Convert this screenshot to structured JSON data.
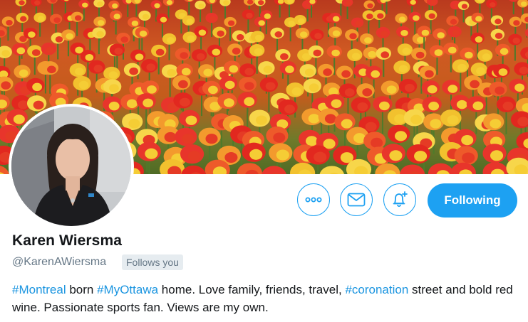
{
  "profile": {
    "name": "Karen Wiersma",
    "handle": "@KarenAWiersma",
    "follows_badge": "Follows you"
  },
  "bio": {
    "tag1": "#Montreal",
    "t1": " born ",
    "tag2": "#MyOttawa",
    "t2": " home. Love family, friends, travel, ",
    "tag3": "#coronation",
    "t3": " street and bold red wine. Passionate sports fan. Views are my own."
  },
  "actions": {
    "following_label": "Following",
    "more_icon": "more-dots-icon",
    "message_icon": "envelope-icon",
    "notify_icon": "bell-plus-icon"
  },
  "colors": {
    "accent": "#1da1f2",
    "link": "#1b95e0",
    "secondary_text": "#657786",
    "badge_bg": "#e6ecf0"
  }
}
